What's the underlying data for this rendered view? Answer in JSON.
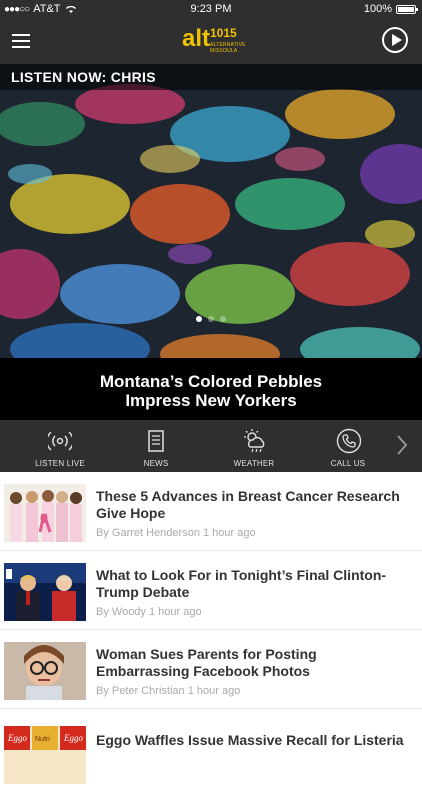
{
  "status": {
    "carrier": "AT&T",
    "time": "9:23 PM",
    "battery": "100%"
  },
  "nav": {
    "logo_main": "alt",
    "logo_freq": "1015",
    "logo_sub": "ALTERNATIVE MISSOULA"
  },
  "listen": {
    "label": "LISTEN NOW: CHRIS"
  },
  "hero": {
    "caption_line1": "Montana’s Colored Pebbles",
    "caption_line2": "Impress New Yorkers",
    "slide_index": 1,
    "slide_count": 3
  },
  "quick": [
    {
      "label": "LISTEN LIVE",
      "icon": "broadcast-icon"
    },
    {
      "label": "NEWS",
      "icon": "newspaper-icon"
    },
    {
      "label": "WEATHER",
      "icon": "weather-icon"
    },
    {
      "label": "CALL US",
      "icon": "phone-icon"
    }
  ],
  "articles": [
    {
      "title": "These 5 Advances in Breast Cancer Research Give Hope",
      "byline": "By Garret Henderson",
      "age": "1 hour ago"
    },
    {
      "title": "What to Look For in Tonight’s Final Clinton-Trump Debate",
      "byline": "By Woody",
      "age": "1 hour ago"
    },
    {
      "title": "Woman Sues Parents for Posting Embarrassing Facebook Photos",
      "byline": "By Peter Christian",
      "age": "1 hour ago"
    },
    {
      "title": "Eggo Waffles Issue Massive Recall for Listeria",
      "byline": "",
      "age": ""
    }
  ]
}
